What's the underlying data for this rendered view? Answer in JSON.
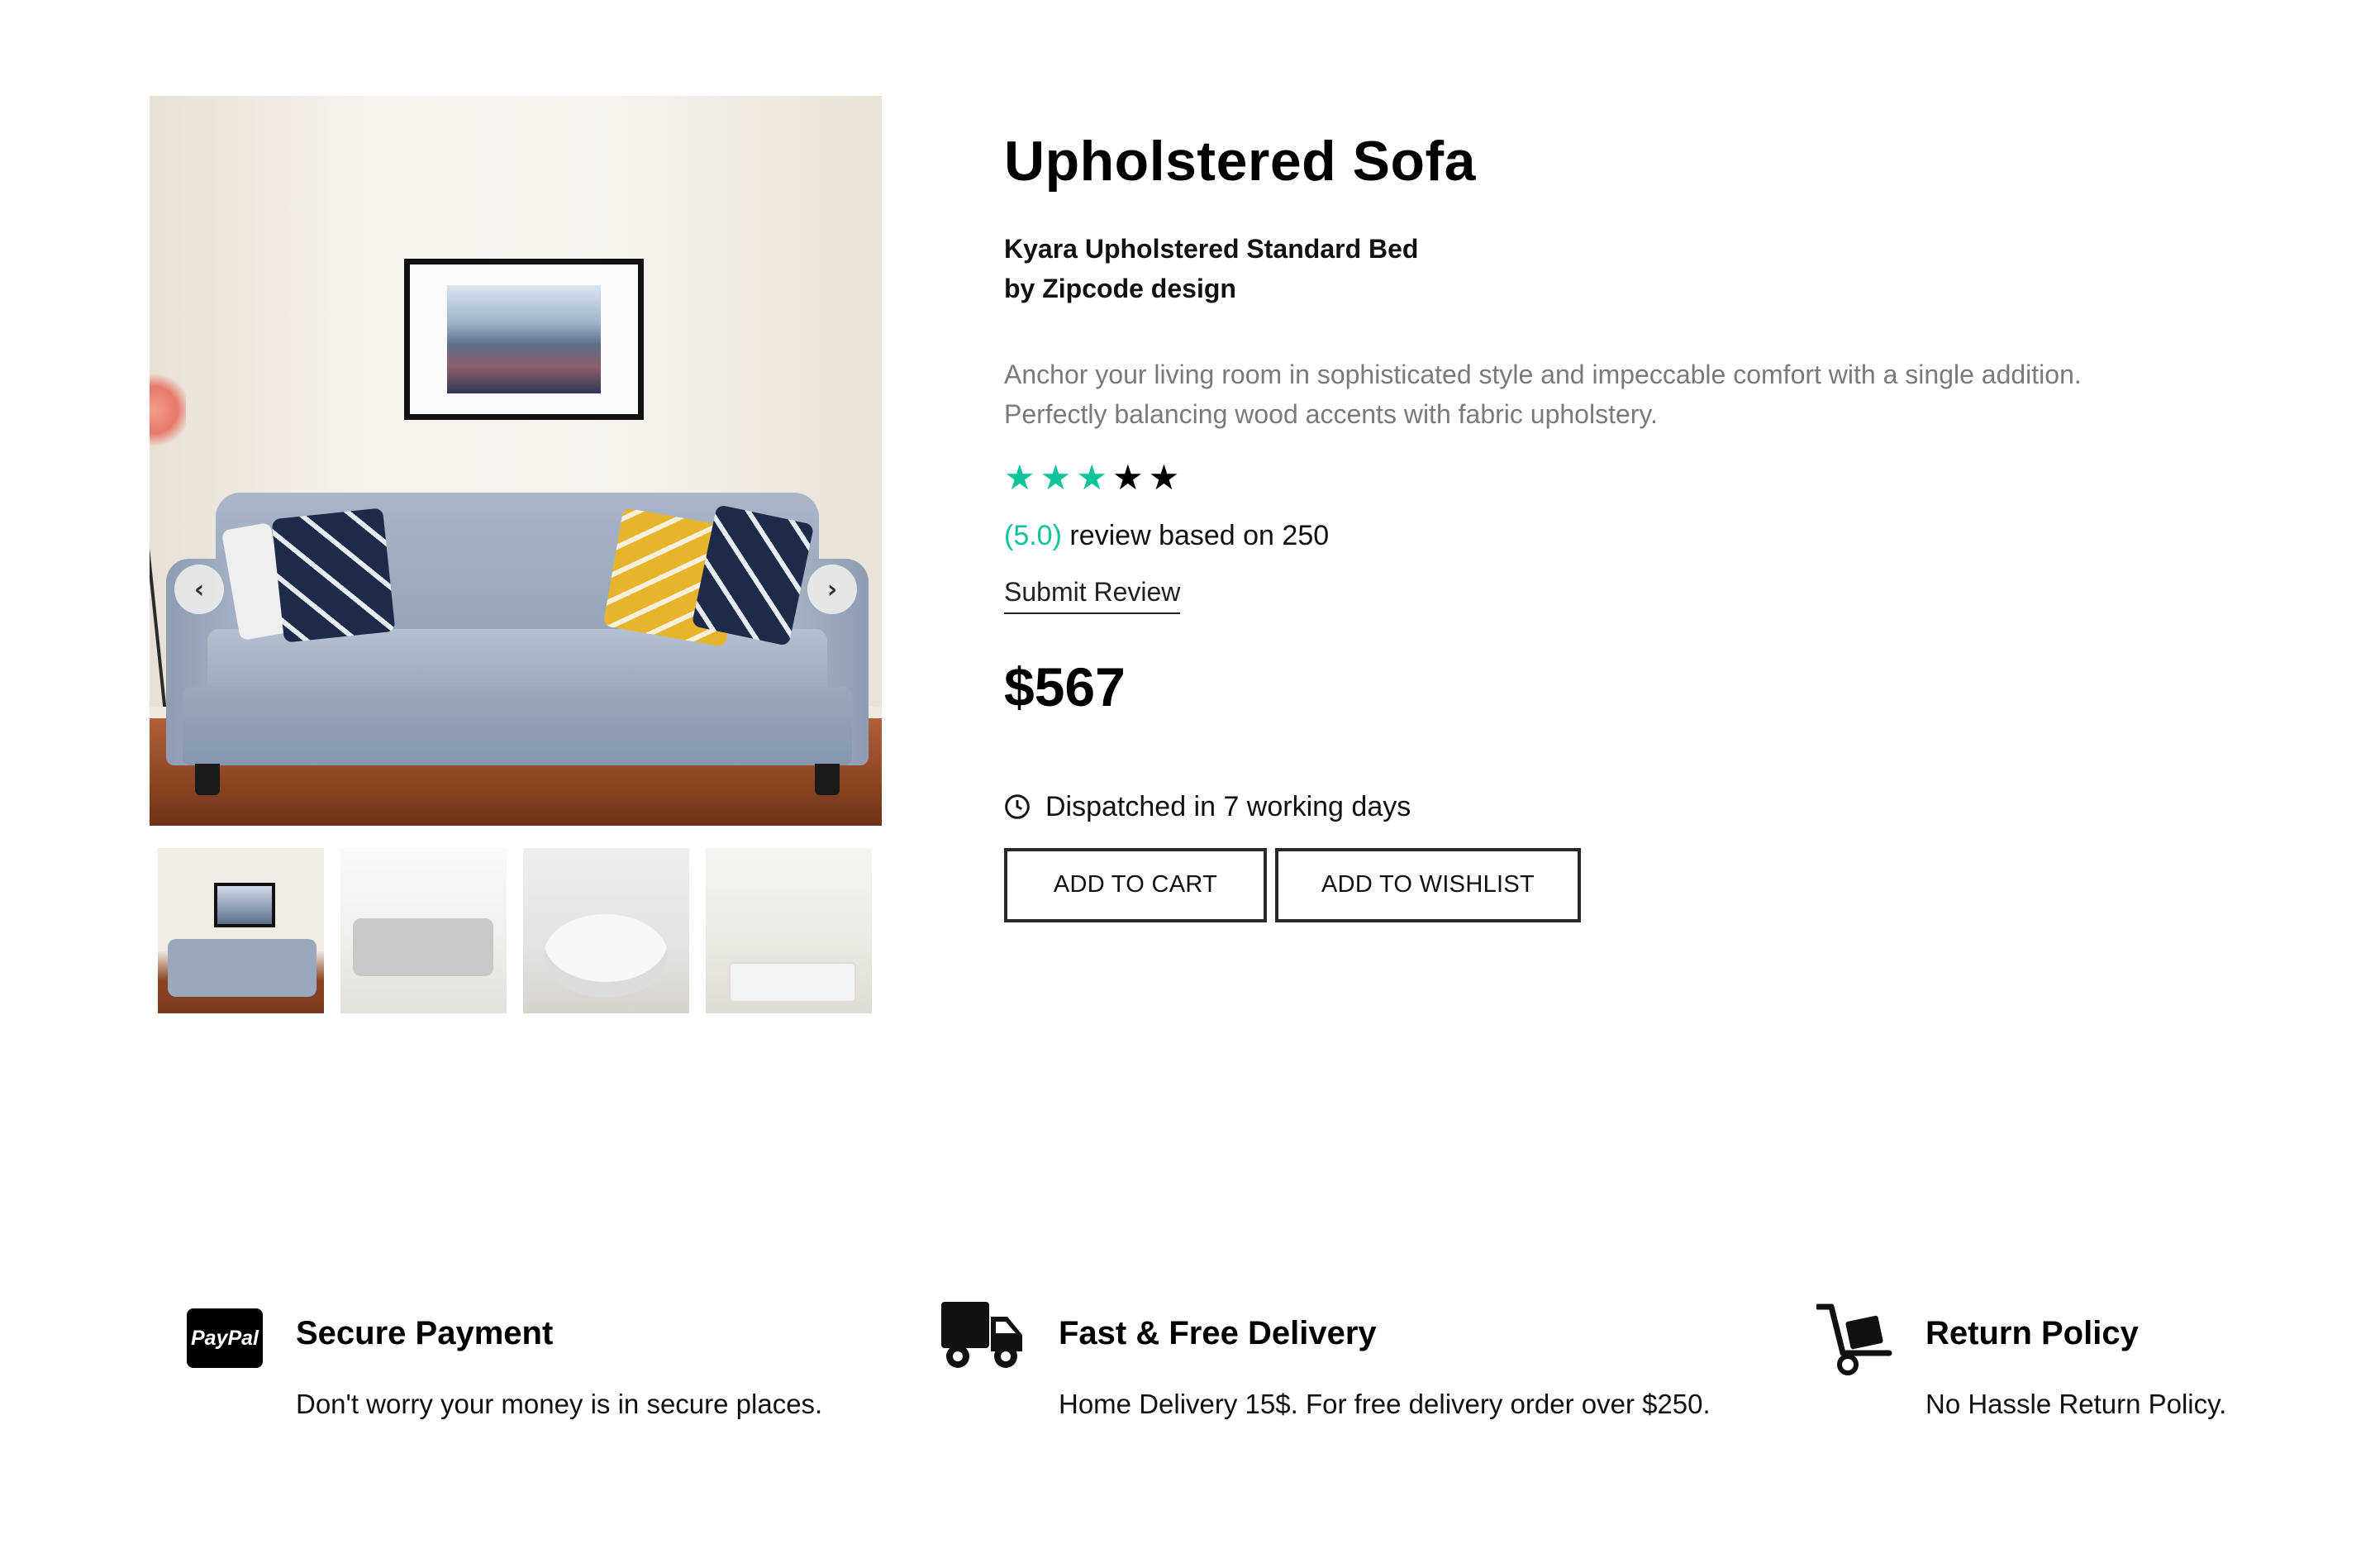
{
  "gallery": {
    "main_image_alt": "Grey upholstered sofa with patterned cushions",
    "prev_label": "‹",
    "next_label": "›",
    "thumbnails": [
      "thumb-1",
      "thumb-2",
      "thumb-3",
      "thumb-4"
    ]
  },
  "product": {
    "title": "Upholstered Sofa",
    "subtitle_line1": "Kyara Upholstered Standard Bed",
    "subtitle_line2": "by Zipcode design",
    "description_line1": "Anchor your living room in sophisticated style and impeccable comfort with a single addition.",
    "description_line2": "Perfectly balancing wood accents with fabric upholstery.",
    "rating": 3,
    "rating_max": 5,
    "rating_score": "(5.0)",
    "rating_text": " review based on 250",
    "submit_review": "Submit Review",
    "price": "$567",
    "dispatch": "Dispatched in 7 working days",
    "add_to_cart": "ADD TO CART",
    "add_to_wishlist": "ADD TO WISHLIST"
  },
  "features": {
    "payment": {
      "icon": "paypal-icon",
      "icon_text": "PayPal",
      "title": "Secure Payment",
      "text": "Don't worry your money is in secure places."
    },
    "delivery": {
      "icon": "truck-icon",
      "title": "Fast & Free Delivery",
      "text": "Home Delivery 15$. For free delivery order over $250."
    },
    "returns": {
      "icon": "hand-truck-icon",
      "title": "Return Policy",
      "text": "No Hassle Return Policy."
    }
  },
  "colors": {
    "accent": "#0fc49a",
    "text": "#111111",
    "muted": "#7a7a7a"
  }
}
